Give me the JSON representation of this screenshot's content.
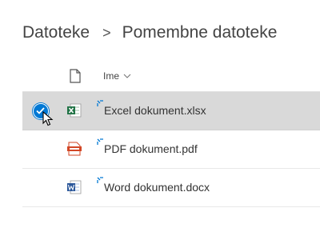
{
  "breadcrumb": {
    "root": "Datoteke",
    "separator": ">",
    "current": "Pomembne datoteke"
  },
  "list_header": {
    "name_column": "Ime",
    "type_column_icon": "document-icon",
    "sort_icon": "chevron-down-icon"
  },
  "files": [
    {
      "name": "Excel dokument.xlsx",
      "type": "excel",
      "icon": "excel-icon",
      "selected": true
    },
    {
      "name": "PDF dokument.pdf",
      "type": "pdf",
      "icon": "pdf-icon",
      "selected": false
    },
    {
      "name": "Word dokument.docx",
      "type": "word",
      "icon": "word-icon",
      "selected": false
    }
  ],
  "colors": {
    "accent": "#0078d4",
    "selected_row": "#d9d9d9",
    "excel": "#217346",
    "word": "#2b579a",
    "pdf": "#d24726",
    "new_marker": "#0078d4"
  }
}
